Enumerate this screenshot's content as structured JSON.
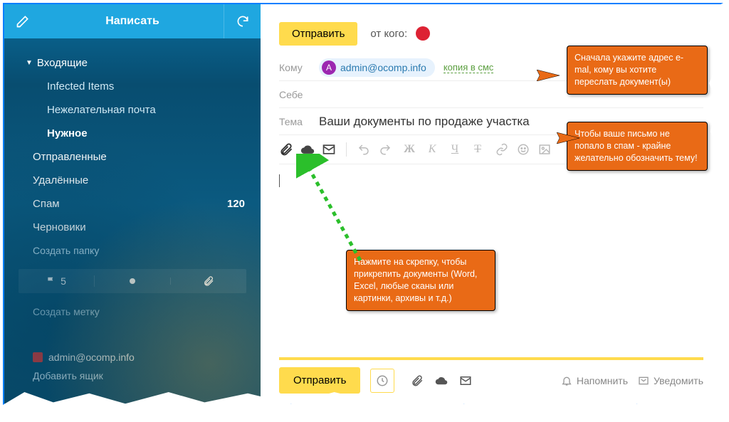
{
  "sidebar": {
    "compose_label": "Написать",
    "folders": {
      "inbox": "Входящие",
      "infected": "Infected Items",
      "junk": "Нежелательная почта",
      "important": "Нужное",
      "sent": "Отправленные",
      "deleted": "Удалённые",
      "spam": "Спам",
      "spam_count": "120",
      "drafts": "Черновики",
      "create_folder": "Создать папку",
      "flag_count": "5",
      "create_label": "Создать метку",
      "account": "admin@ocomp.info",
      "add_mailbox": "Добавить ящик"
    }
  },
  "compose": {
    "send": "Отправить",
    "from_label": "от кого:",
    "to_label": "Кому",
    "self_label": "Себе",
    "subject_label": "Тема",
    "recipient_email": "admin@ocomp.info",
    "recipient_initial": "A",
    "copy_sms": "копия в смс",
    "subject_value": "Ваши документы по продаже участка",
    "remind": "Напомнить",
    "notify": "Уведомить"
  },
  "callouts": {
    "c1": "Сначала укажите адрес e-mal, кому вы хотите переслать документ(ы)",
    "c2": "Чтобы ваше письмо не попало в спам - крайне желательно обозначить тему!",
    "c3": "Нажмите на скрепку, чтобы прикрепить документы (Word, Excel, любые сканы или картинки, архивы и т.д.)"
  }
}
